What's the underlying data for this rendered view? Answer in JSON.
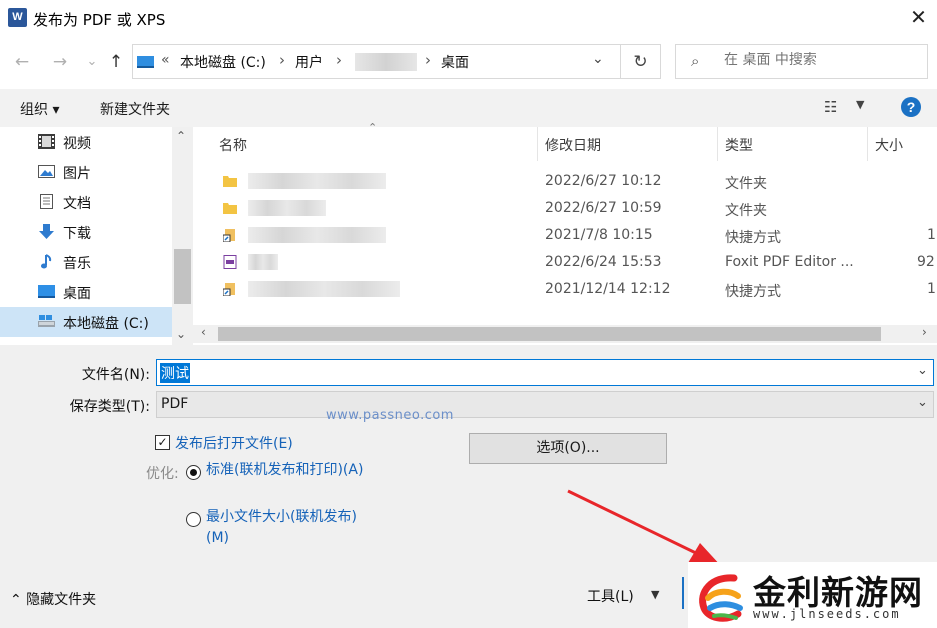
{
  "window": {
    "app_icon": "W",
    "title": "发布为 PDF 或 XPS",
    "close": "✕"
  },
  "nav": {
    "back": "←",
    "forward": "→",
    "recent": "⌄",
    "up": "↑"
  },
  "address": {
    "prefix": "«",
    "crumbs": [
      "本地磁盘 (C:)",
      "用户",
      "桌面"
    ],
    "arrow": "›",
    "dropdown": "⌄",
    "refresh": "↻"
  },
  "search": {
    "placeholder": "在 桌面 中搜索",
    "icon": "⌕"
  },
  "toolbar": {
    "organize": "组织 ▾",
    "new_folder": "新建文件夹",
    "view": "☷",
    "view_dd": "▼",
    "help": "?"
  },
  "sidebar": {
    "items": [
      {
        "label": "视频",
        "icon": "video-icon"
      },
      {
        "label": "图片",
        "icon": "pictures-icon"
      },
      {
        "label": "文档",
        "icon": "documents-icon"
      },
      {
        "label": "下载",
        "icon": "downloads-icon"
      },
      {
        "label": "音乐",
        "icon": "music-icon"
      },
      {
        "label": "桌面",
        "icon": "desktop-icon"
      },
      {
        "label": "本地磁盘 (C:)",
        "icon": "drive-icon"
      }
    ],
    "selected": "本地磁盘 (C:)",
    "scroll_up": "⌃",
    "scroll_down": "⌄"
  },
  "file_list": {
    "columns": [
      "名称",
      "修改日期",
      "类型",
      "大小"
    ],
    "sort_arrow": "⌃",
    "rows": [
      {
        "date": "2022/6/27 10:12",
        "type": "文件夹",
        "size": "",
        "icon": "folder-icon"
      },
      {
        "date": "2022/6/27 10:59",
        "type": "文件夹",
        "size": "",
        "icon": "folder-icon"
      },
      {
        "date": "2021/7/8 10:15",
        "type": "快捷方式",
        "size": "1",
        "icon": "shortcut-icon"
      },
      {
        "date": "2022/6/24 15:53",
        "type": "Foxit PDF Editor ...",
        "size": "92",
        "icon": "pdf-icon"
      },
      {
        "date": "2021/12/14 12:12",
        "type": "快捷方式",
        "size": "1",
        "icon": "shortcut-icon"
      }
    ],
    "scroll_left": "‹",
    "scroll_right": "›"
  },
  "form": {
    "filename_label": "文件名(N):",
    "filename_value": "测试",
    "filetype_label": "保存类型(T):",
    "filetype_value": "PDF",
    "dropdown": "⌄",
    "open_after_label": "发布后打开文件(E)",
    "open_after_checked": "✓",
    "optimize_label": "优化:",
    "radio_standard": "标准(联机发布和打印)(A)",
    "radio_minimum": "最小文件大小(联机发布)(M)",
    "options_button": "选项(O)...",
    "watermark": "www.passneo.com"
  },
  "footer": {
    "hide_folders": "⌃  隐藏文件夹",
    "tools": "工具(L)",
    "tools_dd": "▼"
  },
  "logo": {
    "title": "金利新游网",
    "url": "www.jlnseeds.com"
  },
  "colors": {
    "accent": "#0078d7",
    "link": "#1562b8",
    "arrow": "#e8262a",
    "selection": "#cde4f7"
  }
}
